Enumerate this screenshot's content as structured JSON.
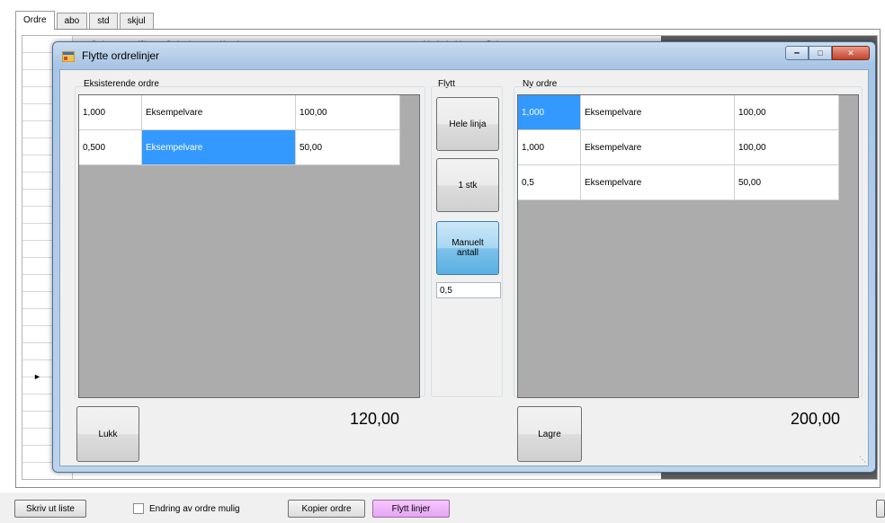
{
  "background": {
    "tabs": [
      "Ordre",
      "abo",
      "std",
      "skjul"
    ],
    "grid_columns": [
      "Ordrenr",
      "(S)",
      "Ordredato",
      "Kunde",
      "Medarbeider",
      "Beløp"
    ],
    "footer": {
      "export_button": "Skriv ut liste",
      "edit_checkbox_label": "Endring av ordre mulig",
      "copy_button": "Kopier ordre",
      "move_button": "Flytt linjer"
    }
  },
  "dialog": {
    "title": "Flytte ordrelinjer",
    "existing": {
      "label": "Eksisterende ordre",
      "rows": [
        [
          "1,000",
          "Eksempelvare",
          "100,00"
        ],
        [
          "0,500",
          "Eksempelvare",
          "50,00"
        ]
      ],
      "total": "120,00",
      "close_button": "Lukk"
    },
    "move": {
      "label": "Flytt",
      "whole_line_button": "Hele linja",
      "one_piece_button": "1 stk",
      "manual_button_line1": "Manuelt",
      "manual_button_line2": "antall",
      "manual_value": "0,5"
    },
    "new_order": {
      "label": "Ny ordre",
      "rows": [
        [
          "1,000",
          "Eksempelvare",
          "100,00"
        ],
        [
          "1,000",
          "Eksempelvare",
          "100,00"
        ],
        [
          "0,5",
          "Eksempelvare",
          "50,00"
        ]
      ],
      "total": "200,00",
      "save_button": "Lagre"
    }
  },
  "colors": {
    "selection": "#3399ff",
    "grid_empty": "#acacac",
    "dialog_frame": "#a9c5e4",
    "pink_button": "#e6a6f2"
  }
}
